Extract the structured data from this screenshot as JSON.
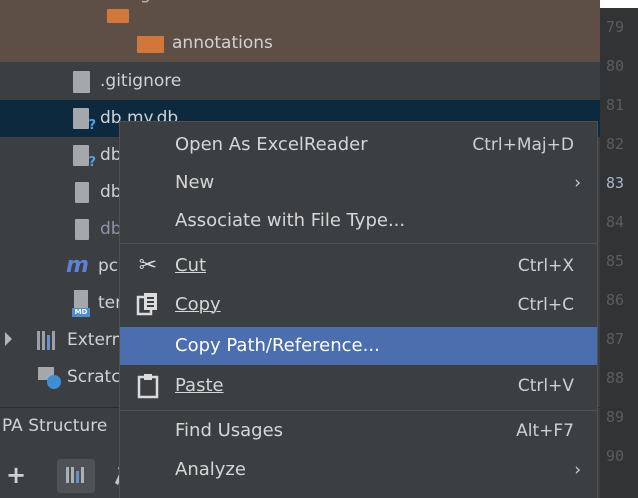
{
  "tree": {
    "items": [
      {
        "label": "generated-sources"
      },
      {
        "label": "annotations"
      },
      {
        "label": ".gitignore"
      },
      {
        "label": "db.my.db"
      },
      {
        "label": "db"
      },
      {
        "label": "db"
      },
      {
        "label": "db"
      },
      {
        "label": "pc"
      },
      {
        "label": "ter"
      },
      {
        "label": "Extern"
      },
      {
        "label": "Scratc"
      }
    ],
    "colors": {
      "selected_row": "#0d293e",
      "generated_row": "#5d4f45",
      "folder": "#d1773c"
    }
  },
  "gutter": {
    "lines": [
      "79",
      "80",
      "81",
      "82",
      "83",
      "84",
      "85",
      "86",
      "87",
      "88",
      "89",
      "90"
    ],
    "current_line": "83"
  },
  "bottom_panel": {
    "title": "PA Structure",
    "add_button": "+"
  },
  "context_menu": {
    "highlight_color": "#4b6eaf",
    "items": [
      {
        "label": "Open As ExcelReader",
        "shortcut": "Ctrl+Maj+D"
      },
      {
        "label": "New",
        "submenu": "›"
      },
      {
        "label": "Associate with File Type..."
      },
      {
        "label": "Cut",
        "shortcut": "Ctrl+X",
        "icon": "scissors-icon"
      },
      {
        "label": "Copy",
        "shortcut": "Ctrl+C",
        "icon": "copy-icon"
      },
      {
        "label": "Copy Path/Reference..."
      },
      {
        "label": "Paste",
        "shortcut": "Ctrl+V",
        "icon": "paste-icon"
      },
      {
        "label": "Find Usages",
        "shortcut": "Alt+F7"
      },
      {
        "label": "Analyze",
        "submenu": "›"
      }
    ]
  }
}
